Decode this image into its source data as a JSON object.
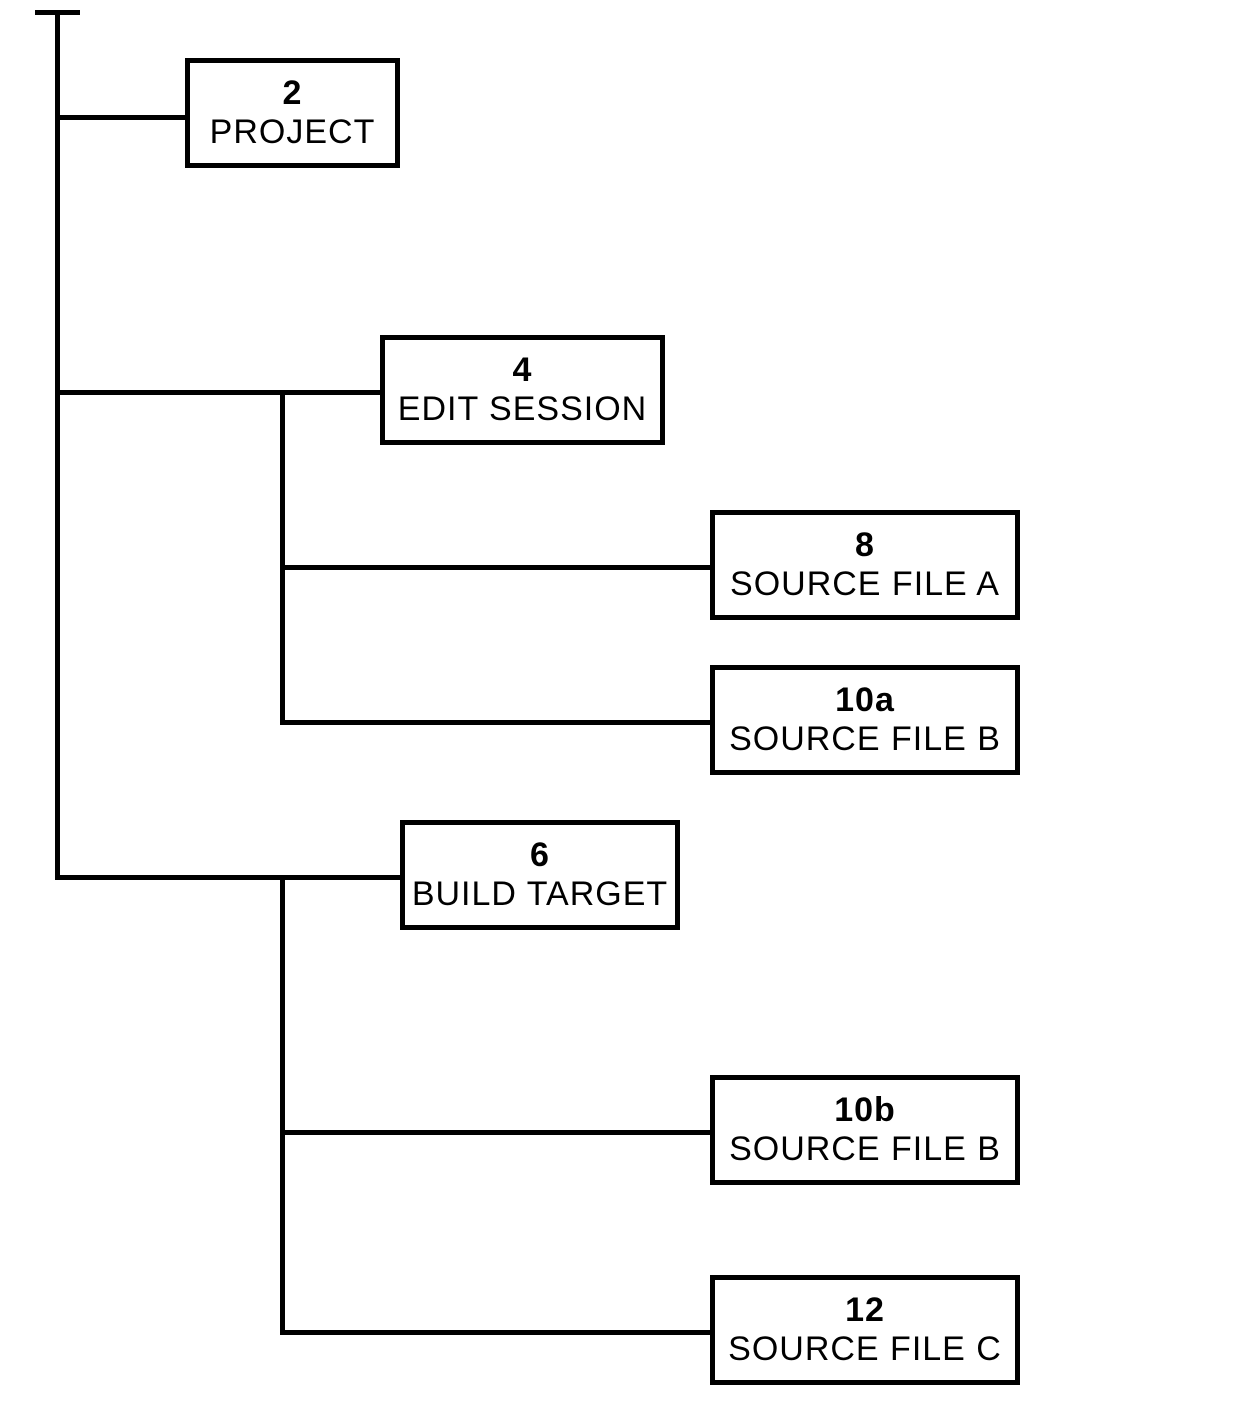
{
  "diagram": {
    "nodes": {
      "project": {
        "num": "2",
        "label": "PROJECT"
      },
      "edit_session": {
        "num": "4",
        "label": "EDIT SESSION"
      },
      "source_file_a": {
        "num": "8",
        "label": "SOURCE FILE A"
      },
      "source_file_b1": {
        "num": "10a",
        "label": "SOURCE FILE B"
      },
      "build_target": {
        "num": "6",
        "label": "BUILD TARGET"
      },
      "source_file_b2": {
        "num": "10b",
        "label": "SOURCE FILE B"
      },
      "source_file_c": {
        "num": "12",
        "label": "SOURCE FILE C"
      }
    }
  }
}
